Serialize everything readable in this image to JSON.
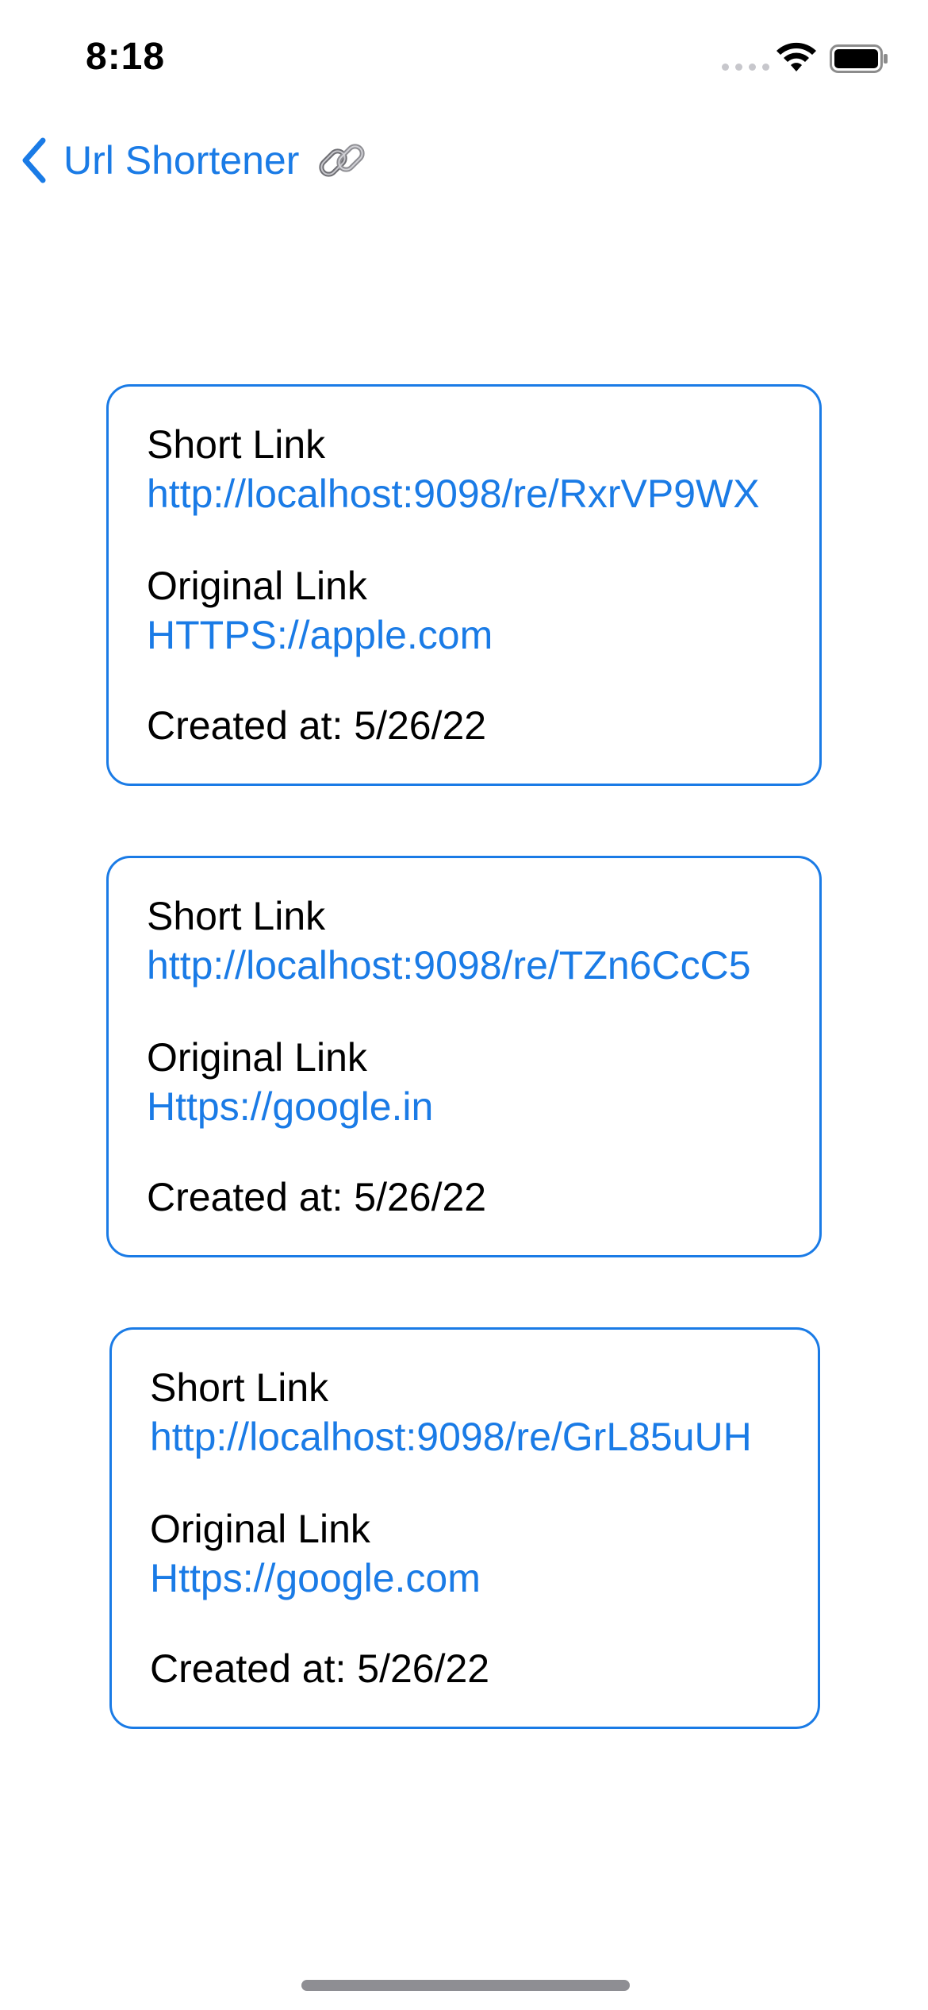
{
  "status": {
    "time": "8:18"
  },
  "nav": {
    "back_title": "Url Shortener"
  },
  "cards": [
    {
      "short_label": "Short Link",
      "short_url": "http://localhost:9098/re/RxrVP9WX",
      "original_label": "Original Link",
      "original_url": "HTTPS://apple.com",
      "created": "Created at: 5/26/22"
    },
    {
      "short_label": "Short Link",
      "short_url": "http://localhost:9098/re/TZn6CcC5",
      "original_label": "Original Link",
      "original_url": "Https://google.in",
      "created": "Created at: 5/26/22"
    },
    {
      "short_label": "Short Link",
      "short_url": "http://localhost:9098/re/GrL85uUH",
      "original_label": "Original Link",
      "original_url": "Https://google.com",
      "created": "Created at: 5/26/22"
    }
  ],
  "colors": {
    "accent": "#1a7be6"
  },
  "icons": {
    "back": "chevron-left-icon",
    "title_emoji": "link-icon"
  }
}
